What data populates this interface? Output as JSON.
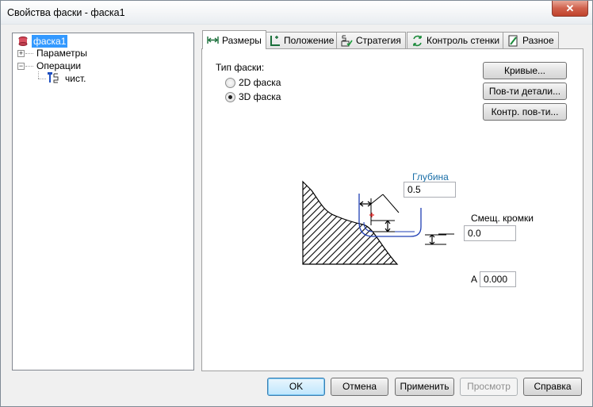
{
  "window": {
    "title": "Свойства фаски - фаска1",
    "close_label": "✕"
  },
  "tree": {
    "root": "фаска1",
    "items": [
      {
        "label": "Параметры",
        "expander": "+"
      },
      {
        "label": "Операции",
        "expander": "−"
      },
      {
        "label": "чист."
      }
    ]
  },
  "tabs": [
    {
      "label": "Размеры",
      "icon": "dimensions-icon",
      "active": true
    },
    {
      "label": "Положение",
      "icon": "position-icon"
    },
    {
      "label": "Стратегия",
      "icon": "strategy-icon"
    },
    {
      "label": "Контроль стенки",
      "icon": "wall-control-icon"
    },
    {
      "label": "Разное",
      "icon": "misc-icon"
    }
  ],
  "dimensions": {
    "chamfer_type_label": "Тип фаски:",
    "options": [
      {
        "label": "2D фаска",
        "checked": false
      },
      {
        "label": "3D фаска",
        "checked": true
      }
    ],
    "side_buttons": [
      "Кривые...",
      "Пов-ти детали...",
      "Контр. пов-ти..."
    ],
    "depth_label": "Глубина",
    "depth_value": "0.5",
    "edge_offset_label": "Смещ. кромки",
    "edge_offset_value": "0.0",
    "a_label": "A",
    "a_value": "0.000"
  },
  "footer": {
    "ok": "OK",
    "cancel": "Отмена",
    "apply": "Применить",
    "preview": "Просмотр",
    "help": "Справка"
  },
  "colors": {
    "selection": "#3399ff",
    "tool_path": "#1f3fb4",
    "label_blue": "#1a6fa8",
    "marker_red": "#e02020"
  }
}
